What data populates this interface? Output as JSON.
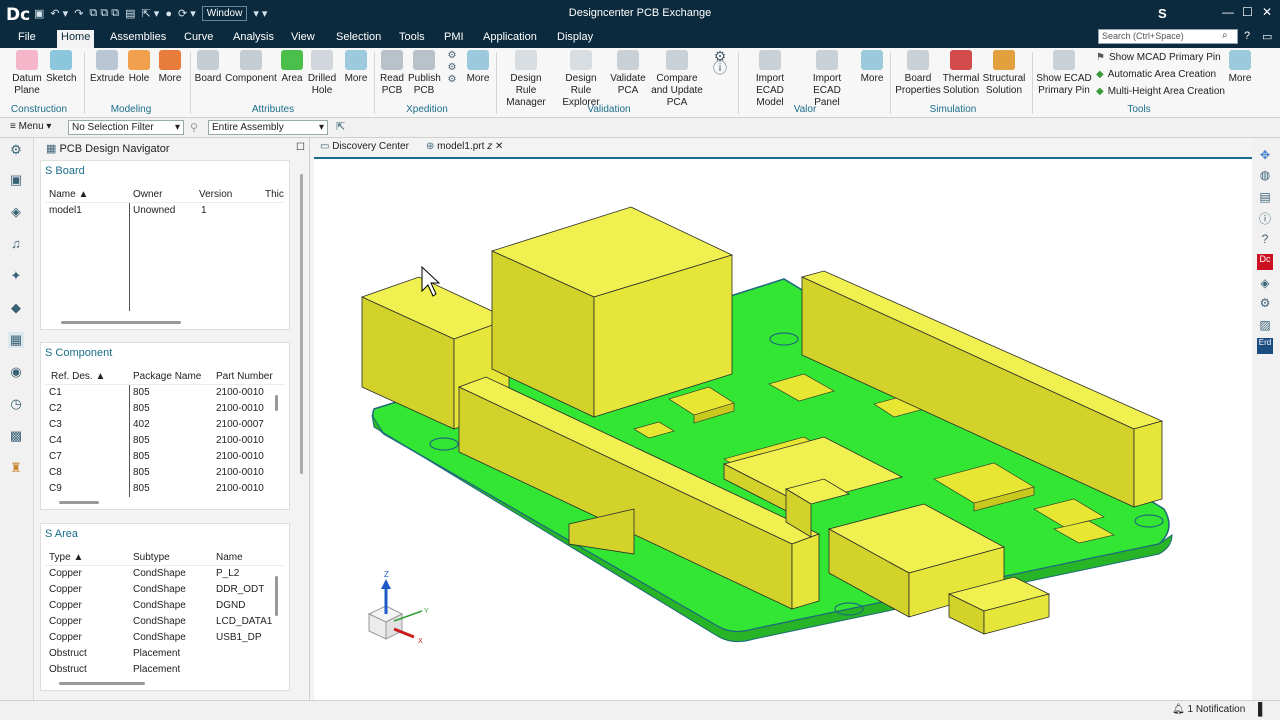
{
  "app": {
    "logo": "Dc",
    "title": "Designcenter PCB Exchange",
    "user_initial": "S",
    "window_menu": "Window"
  },
  "menu": {
    "tabs": [
      "File",
      "Home",
      "Assemblies",
      "Curve",
      "Analysis",
      "View",
      "Selection",
      "Tools",
      "PMI",
      "Application",
      "Display"
    ],
    "search_placeholder": "Search (Ctrl+Space)"
  },
  "ribbon": {
    "buttons": {
      "datum_plane": "Datum Plane",
      "sketch": "Sketch",
      "extrude": "Extrude",
      "hole": "Hole",
      "more1": "More",
      "board": "Board",
      "component": "Component",
      "area": "Area",
      "drilled_hole": "Drilled Hole",
      "more2": "More",
      "read_pcb": "Read PCB",
      "publish_pcb": "Publish PCB",
      "more3": "More",
      "drc_manager": "Design Rule Manager",
      "drc_explorer": "Design Rule Explorer",
      "validate_pca": "Validate PCA",
      "compare_update": "Compare and Update PCA",
      "import_ecad_model": "Import ECAD Model",
      "import_ecad_panel": "Import ECAD Panel",
      "more4": "More",
      "board_properties": "Board Properties",
      "thermal_solution": "Thermal Solution",
      "structural_solution": "Structural Solution",
      "show_ecad_primary": "Show ECAD Primary Pin",
      "show_mcad_primary": "Show MCAD Primary Pin",
      "auto_area": "Automatic Area Creation",
      "multi_height": "Multi-Height Area Creation",
      "more5": "More"
    },
    "groups": [
      "Construction",
      "Modeling",
      "Attributes",
      "Xpedition",
      "Validation",
      "Valor",
      "Simulation",
      "Tools"
    ]
  },
  "toolbar": {
    "menu": "Menu",
    "selection_filter": "No Selection Filter",
    "scope": "Entire Assembly"
  },
  "navigator": {
    "title": "PCB Design Navigator",
    "board": {
      "title": "Board",
      "columns": [
        "Name",
        "Owner",
        "Version",
        "Thic"
      ],
      "rows": [
        [
          "model1",
          "Unowned",
          "1",
          ""
        ]
      ]
    },
    "component": {
      "title": "Component",
      "columns": [
        "Ref. Des.",
        "Package Name",
        "Part Number"
      ],
      "rows": [
        [
          "C1",
          "805",
          "2100-0010"
        ],
        [
          "C2",
          "805",
          "2100-0010"
        ],
        [
          "C3",
          "402",
          "2100-0007"
        ],
        [
          "C4",
          "805",
          "2100-0010"
        ],
        [
          "C7",
          "805",
          "2100-0010"
        ],
        [
          "C8",
          "805",
          "2100-0010"
        ],
        [
          "C9",
          "805",
          "2100-0010"
        ]
      ]
    },
    "area": {
      "title": "Area",
      "columns": [
        "Type",
        "Subtype",
        "Name"
      ],
      "rows": [
        [
          "Copper",
          "CondShape",
          "P_L2"
        ],
        [
          "Copper",
          "CondShape",
          "DDR_ODT"
        ],
        [
          "Copper",
          "CondShape",
          "DGND"
        ],
        [
          "Copper",
          "CondShape",
          "LCD_DATA1"
        ],
        [
          "Copper",
          "CondShape",
          "USB1_DP"
        ],
        [
          "Obstruct",
          "Placement",
          ""
        ],
        [
          "Obstruct",
          "Placement",
          ""
        ]
      ]
    }
  },
  "doc_tabs": [
    "Discovery Center",
    "model1.prt"
  ],
  "status": {
    "notification": "1 Notification"
  },
  "colors": {
    "board": "#33e633",
    "component": "#e6e633",
    "accent": "#1a6d8a",
    "title_bar": "#0b2a3d"
  }
}
